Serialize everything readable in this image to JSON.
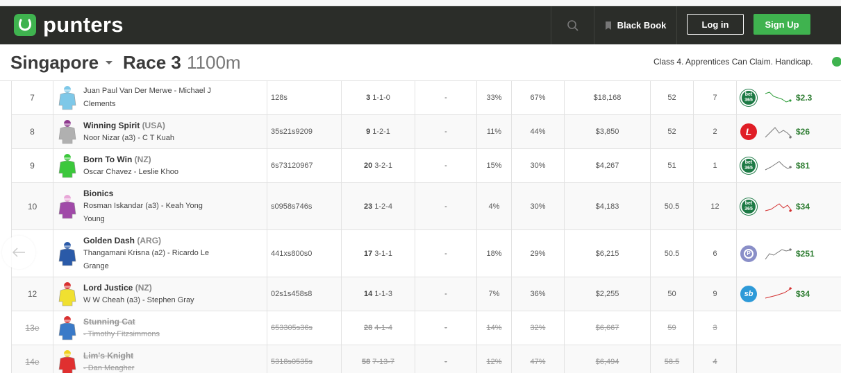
{
  "header": {
    "logo_text": "punters",
    "blackbook_label": "Black Book",
    "login_label": "Log in",
    "signup_label": "Sign Up"
  },
  "race": {
    "venue": "Singapore",
    "race_label": "Race 3",
    "distance": "1100m",
    "conditions": "Class 4. Apprentices Can Claim. Handicap."
  },
  "runners": [
    {
      "no": "7",
      "name": "",
      "country": "",
      "jockey_trainer": "Juan Paul Van Der Merwe - Michael J Clements",
      "form": "128s",
      "career_bold": "3",
      "career": "1-1-0",
      "dash": "-",
      "win": "33%",
      "place": "67%",
      "prize": "$18,168",
      "weight": "52",
      "barrier": "7",
      "bookie": "bet365",
      "price": "$2.3",
      "silk": "#7ec8e8",
      "cap": "#7ec8e8"
    },
    {
      "no": "8",
      "name": "Winning Spirit",
      "country": "(USA)",
      "jockey_trainer": "Noor Nizar (a3) - C T Kuah",
      "form": "35s21s9209",
      "career_bold": "9",
      "career": "1-2-1",
      "dash": "-",
      "win": "11%",
      "place": "44%",
      "prize": "$3,850",
      "weight": "52",
      "barrier": "2",
      "bookie": "ladbrokes",
      "price": "$26",
      "silk": "#b0b0b0",
      "cap": "#8e3a8e"
    },
    {
      "no": "9",
      "name": "Born To Win",
      "country": "(NZ)",
      "jockey_trainer": "Oscar Chavez - Leslie Khoo",
      "form": "6s73120967",
      "career_bold": "20",
      "career": "3-2-1",
      "dash": "-",
      "win": "15%",
      "place": "30%",
      "prize": "$4,267",
      "weight": "51",
      "barrier": "1",
      "bookie": "bet365",
      "price": "$81",
      "silk": "#3cc83c",
      "cap": "#3cc83c"
    },
    {
      "no": "10",
      "name": "Bionics",
      "country": "",
      "jockey_trainer": "Rosman Iskandar (a3) - Keah Yong Young",
      "form": "s0958s746s",
      "career_bold": "23",
      "career": "1-2-4",
      "dash": "-",
      "win": "4%",
      "place": "30%",
      "prize": "$4,183",
      "weight": "50.5",
      "barrier": "12",
      "bookie": "bet365",
      "price": "$34",
      "silk": "#a04aa8",
      "cap": "#e8a8d8"
    },
    {
      "no": "",
      "name": "Golden Dash",
      "country": "(ARG)",
      "jockey_trainer": "Thangamani Krisna (a2) - Ricardo Le Grange",
      "form": "441xs800s0",
      "career_bold": "17",
      "career": "3-1-1",
      "dash": "-",
      "win": "18%",
      "place": "29%",
      "prize": "$6,215",
      "weight": "50.5",
      "barrier": "6",
      "bookie": "pointsbet",
      "price": "$251",
      "silk": "#2a5aa8",
      "cap": "#2a5aa8"
    },
    {
      "no": "12",
      "name": "Lord Justice",
      "country": "(NZ)",
      "jockey_trainer": "W W Cheah (a3) - Stephen Gray",
      "form": "02s1s458s8",
      "career_bold": "14",
      "career": "1-1-3",
      "dash": "-",
      "win": "7%",
      "place": "36%",
      "prize": "$2,255",
      "weight": "50",
      "barrier": "9",
      "bookie": "sportsbet",
      "price": "$34",
      "silk": "#f0e030",
      "cap": "#d83030"
    },
    {
      "no": "13e",
      "name": "Stunning Cat",
      "country": "",
      "jockey_trainer": "- Timothy Fitzsimmons",
      "form": "653305s36s",
      "career_bold": "28",
      "career": "4-1-4",
      "dash": "-",
      "win": "14%",
      "place": "32%",
      "prize": "$6,667",
      "weight": "59",
      "barrier": "3",
      "bookie": "",
      "price": "",
      "silk": "#3a7ac8",
      "cap": "#d83030"
    },
    {
      "no": "14e",
      "name": "Lim's Knight",
      "country": "",
      "jockey_trainer": "- Dan Meagher",
      "form": "5318s0535s",
      "career_bold": "58",
      "career": "7-13-7",
      "dash": "-",
      "win": "12%",
      "place": "47%",
      "prize": "$6,494",
      "weight": "58.5",
      "barrier": "4",
      "bookie": "",
      "price": "",
      "silk": "#e03030",
      "cap": "#f0d020"
    }
  ],
  "colors": {
    "brand_green": "#3fb34f",
    "header_dark": "#2b2d29",
    "price_green": "#2e7d32"
  },
  "icons": [
    "horseshoe-icon",
    "search-icon",
    "bookmark-icon",
    "clock-icon",
    "arrow-left-icon",
    "jockey-silk-icon",
    "sparkline-icon"
  ]
}
